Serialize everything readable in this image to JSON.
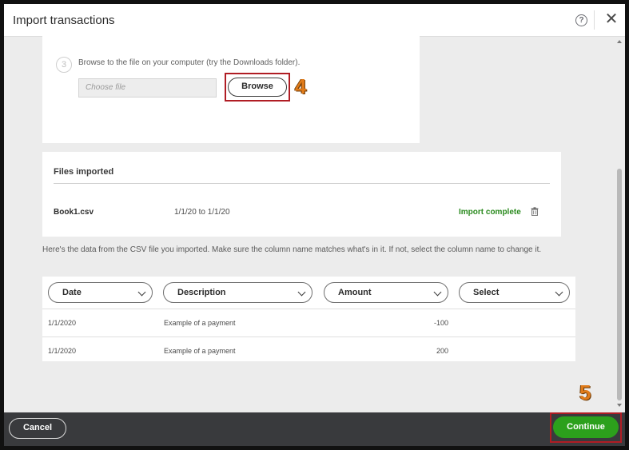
{
  "dialog": {
    "title": "Import transactions",
    "help_icon": "?",
    "close_icon": "✕"
  },
  "step": {
    "number": "3",
    "instruction": "Browse to the file on your computer (try the Downloads folder).",
    "file_placeholder": "Choose file",
    "browse_label": "Browse",
    "callout": "4"
  },
  "files_imported": {
    "heading": "Files imported",
    "file_name": "Book1.csv",
    "date_range": "1/1/20 to 1/1/20",
    "status": "Import complete",
    "status_color": "#2a8a1e"
  },
  "info_text": "Here's the data from the CSV file you imported. Make sure the column name matches what's in it. If not, select the column name to change it.",
  "table": {
    "columns": [
      "Date",
      "Description",
      "Amount",
      "Select"
    ],
    "rows": [
      {
        "date": "1/1/2020",
        "description": "Example of a payment",
        "amount": "-100"
      },
      {
        "date": "1/1/2020",
        "description": "Example of a payment",
        "amount": "200"
      }
    ]
  },
  "footer": {
    "cancel_label": "Cancel",
    "continue_label": "Continue",
    "continue_color": "#2ca01c",
    "callout": "5"
  },
  "highlight_color": "#b01d24",
  "callout_color": "#e07b1a"
}
